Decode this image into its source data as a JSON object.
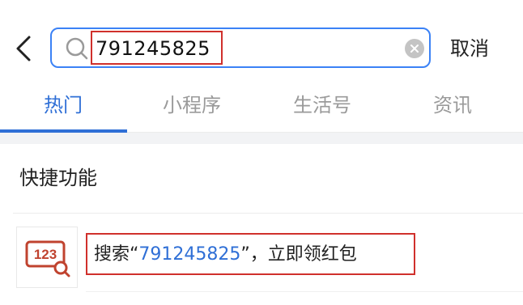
{
  "search": {
    "query": "791245825",
    "cancel_label": "取消"
  },
  "tabs": [
    {
      "label": "热门",
      "active": true
    },
    {
      "label": "小程序",
      "active": false
    },
    {
      "label": "生活号",
      "active": false
    },
    {
      "label": "资讯",
      "active": false
    }
  ],
  "quick_functions": {
    "title": "快捷功能",
    "item": {
      "prefix": "搜索“",
      "query": "791245825",
      "suffix": "”，立即领红包",
      "icon_text": "123"
    }
  },
  "colors": {
    "accent": "#2f6fd6",
    "highlight_box": "#d0302c",
    "icon_red": "#c0432f"
  },
  "icons": {
    "back": "chevron-left-icon",
    "search": "search-icon",
    "clear": "clear-circle-icon",
    "quick": "number-search-icon"
  }
}
